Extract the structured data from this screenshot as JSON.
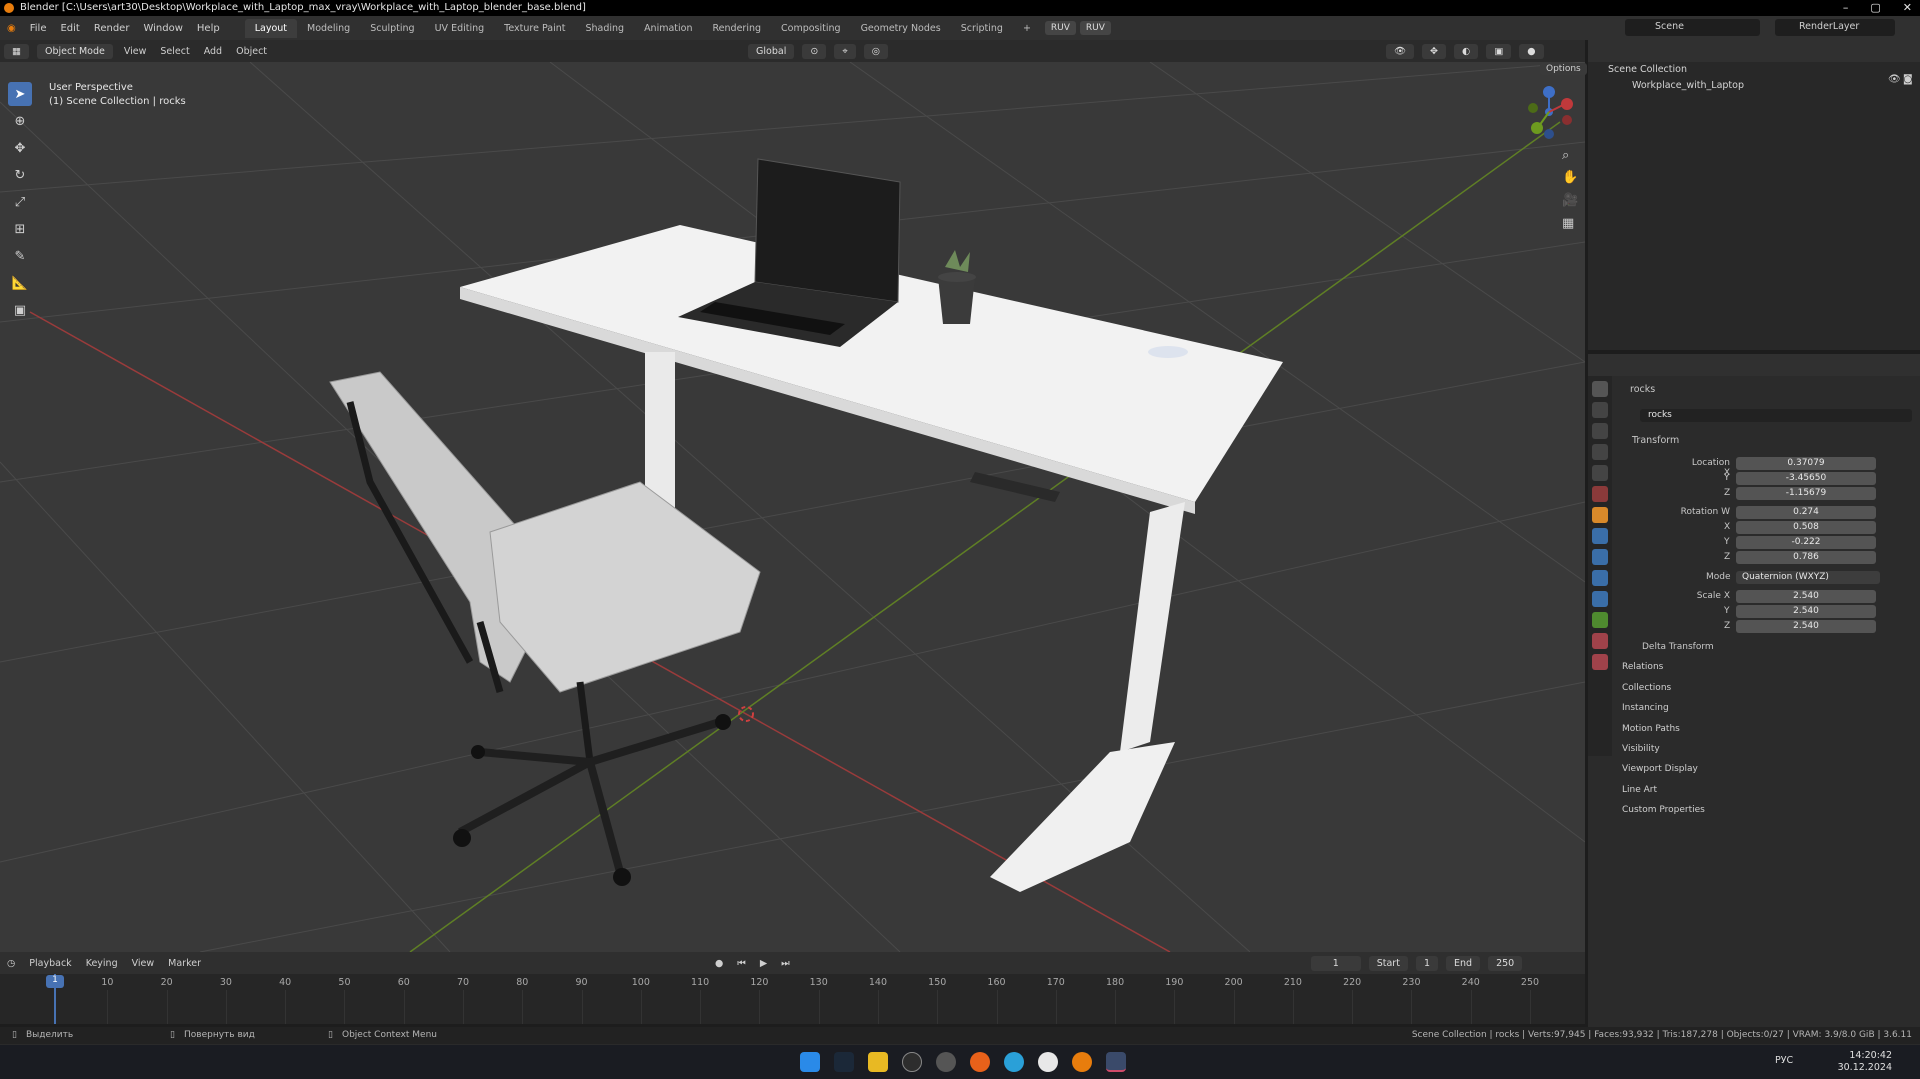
{
  "window": {
    "title": "Blender [C:\\Users\\art30\\Desktop\\Workplace_with_Laptop_max_vray\\Workplace_with_Laptop_blender_base.blend]"
  },
  "menus": [
    "File",
    "Edit",
    "Render",
    "Window",
    "Help"
  ],
  "workspaces": [
    "Layout",
    "Modeling",
    "Sculpting",
    "UV Editing",
    "Texture Paint",
    "Shading",
    "Animation",
    "Rendering",
    "Compositing",
    "Geometry Nodes",
    "Scripting"
  ],
  "addons": [
    "RUV",
    "RUV"
  ],
  "scene": "Scene",
  "render_layer": "RenderLayer",
  "viewport": {
    "mode": "Object Mode",
    "menus": [
      "View",
      "Select",
      "Add",
      "Object"
    ],
    "orientation": "Global",
    "options": "Options",
    "info_line1": "User Perspective",
    "info_line2": "(1) Scene Collection | rocks"
  },
  "outliner": {
    "root": "Scene Collection",
    "item": "Workplace_with_Laptop"
  },
  "properties": {
    "object_name": "rocks",
    "data_name": "rocks",
    "section": "Transform",
    "location_label": "Location X",
    "location": [
      "0.37079",
      "-3.45650",
      "-1.15679"
    ],
    "rotation_label": "Rotation W",
    "rotation": [
      "0.274",
      "0.508",
      "-0.222",
      "0.786"
    ],
    "mode_label": "Mode",
    "mode": "Quaternion (WXYZ)",
    "scale_label": "Scale X",
    "scale": [
      "2.540",
      "2.540",
      "2.540"
    ],
    "axis_y": "Y",
    "axis_z": "Z",
    "axis_x": "X",
    "delta": "Delta Transform",
    "panels": [
      "Relations",
      "Collections",
      "Instancing",
      "Motion Paths",
      "Visibility",
      "Viewport Display",
      "Line Art",
      "Custom Properties"
    ]
  },
  "timeline": {
    "menus": [
      "Playback",
      "Keying",
      "View",
      "Marker"
    ],
    "current_frame": "1",
    "start_label": "Start",
    "start": "1",
    "end_label": "End",
    "end": "250",
    "ticks": [
      "10",
      "20",
      "30",
      "40",
      "50",
      "60",
      "70",
      "80",
      "90",
      "100",
      "110",
      "120",
      "130",
      "140",
      "150",
      "160",
      "170",
      "180",
      "190",
      "200",
      "210",
      "220",
      "230",
      "240",
      "250"
    ]
  },
  "status": {
    "left1": "Выделить",
    "left2": "Повернуть вид",
    "left3": "Object Context Menu",
    "right": "Scene Collection | rocks | Verts:97,945 | Faces:93,932 | Tris:187,278 | Objects:0/27 | VRAM: 3.9/8.0 GiB | 3.6.11"
  },
  "clock": {
    "time": "14:20:42",
    "date": "30.12.2024",
    "lang": "РУС"
  },
  "colors": {
    "accent": "#4772b3",
    "blender_orange": "#e87d0d",
    "x_axis": "#c0393b",
    "y_axis": "#6d9a1f"
  }
}
